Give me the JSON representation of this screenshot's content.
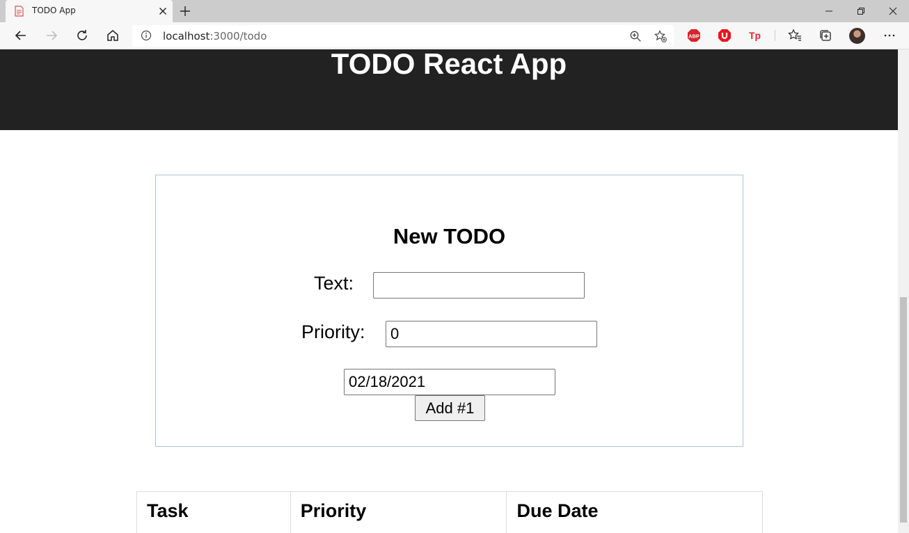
{
  "browser": {
    "tab_title": "TODO App",
    "url_host": "localhost",
    "url_rest": ":3000/todo"
  },
  "header": {
    "title": "TODO React App"
  },
  "form": {
    "title": "New TODO",
    "text_label": "Text:",
    "text_value": "",
    "priority_label": "Priority:",
    "priority_value": "0",
    "date_value": "02/18/2021",
    "add_label": "Add #1"
  },
  "table": {
    "columns": [
      "Task",
      "Priority",
      "Due Date"
    ]
  },
  "extensions": [
    "abp-icon",
    "ublock-icon",
    "tp-icon"
  ],
  "colors": {
    "header_bg": "#222222",
    "form_border": "#a8c4dc",
    "chrome_bg": "#cccccc"
  }
}
